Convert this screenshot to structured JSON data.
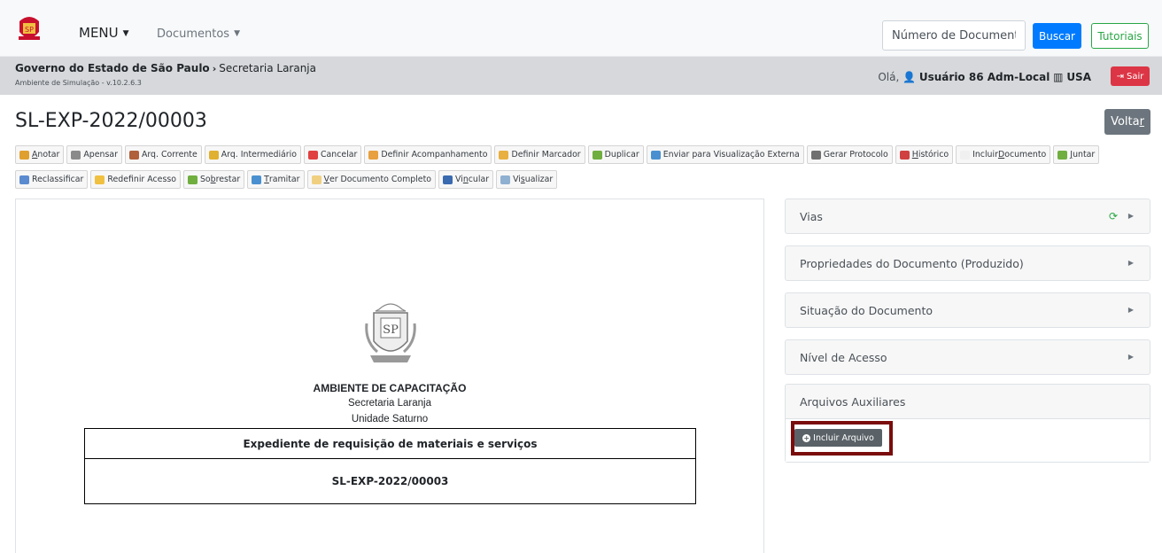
{
  "nav": {
    "menu_label": "MENU",
    "documentos_label": "Documentos",
    "search_placeholder": "Número de Documento",
    "buscar_label": "Buscar",
    "tutoriais_label": "Tutoriais"
  },
  "breadcrumb": {
    "org": "Governo do Estado de São Paulo",
    "separator": "›",
    "unit": "Secretaria Laranja",
    "environment": "Ambiente de Simulação - v.10.2.6.3"
  },
  "user": {
    "greeting": "Olá,",
    "name": "Usuário 86 Adm-Local",
    "unit": "USA",
    "logout_label": "Sair"
  },
  "document": {
    "title": "SL-EXP-2022/00003",
    "back_label_prefix": "Volta",
    "back_label_key": "r"
  },
  "toolbar": [
    {
      "pre": "",
      "key": "A",
      "post": "notar",
      "color": "#e0a030"
    },
    {
      "pre": "",
      "key": "",
      "post": "Apensar",
      "color": "#8a8a8a"
    },
    {
      "pre": "",
      "key": "",
      "post": "Arq. Corrente",
      "color": "#b0603a"
    },
    {
      "pre": "",
      "key": "",
      "post": "Arq. Intermediário",
      "color": "#e0b030"
    },
    {
      "pre": "",
      "key": "",
      "post": "Cancelar",
      "color": "#e04040"
    },
    {
      "pre": "",
      "key": "",
      "post": "Definir Acompanhamento",
      "color": "#e8a040"
    },
    {
      "pre": "",
      "key": "",
      "post": "Definir Marcador",
      "color": "#e8b040"
    },
    {
      "pre": "",
      "key": "",
      "post": "Duplicar",
      "color": "#6fae3f"
    },
    {
      "pre": "",
      "key": "",
      "post": "Enviar para Visualização Externa",
      "color": "#4a90d0"
    },
    {
      "pre": "",
      "key": "",
      "post": "Gerar Protocolo",
      "color": "#707070"
    },
    {
      "pre": "",
      "key": "H",
      "post": "istórico",
      "color": "#d04040"
    },
    {
      "pre": "Incluir ",
      "key": "D",
      "post": "ocumento",
      "color": "#f0f0f0"
    },
    {
      "pre": "",
      "key": "J",
      "post": "untar",
      "color": "#6fae3f"
    },
    {
      "pre": "",
      "key": "",
      "post": "Reclassificar",
      "color": "#5a8ad0"
    },
    {
      "pre": "",
      "key": "",
      "post": "Redefinir Acesso",
      "color": "#f0c040"
    },
    {
      "pre": "So",
      "key": "b",
      "post": "restar",
      "color": "#6fae3f"
    },
    {
      "pre": "",
      "key": "T",
      "post": "ramitar",
      "color": "#4a90d0"
    },
    {
      "pre": "",
      "key": "V",
      "post": "er Documento Completo",
      "color": "#f0d080"
    },
    {
      "pre": "Vi",
      "key": "n",
      "post": "cular",
      "color": "#3a6ab0"
    },
    {
      "pre": "Vi",
      "key": "s",
      "post": "ualizar",
      "color": "#8fb0d0"
    }
  ],
  "preview": {
    "heading": "AMBIENTE DE CAPACITAÇÃO",
    "secretaria": "Secretaria Laranja",
    "unidade": "Unidade Saturno",
    "subject": "Expediente de requisição de materiais e serviços",
    "number": "SL-EXP-2022/00003"
  },
  "side_panels": {
    "vias": "Vias",
    "propriedades": "Propriedades do Documento (Produzido)",
    "situacao": "Situação do Documento",
    "nivel": "Nível de Acesso",
    "arquivos": "Arquivos Auxiliares",
    "incluir_arquivo": "Incluir Arquivo"
  },
  "colors": {
    "primary": "#007bff",
    "success": "#28a745",
    "danger": "#dc3545",
    "secondary": "#6c757d",
    "highlight": "#7a0c0c"
  }
}
